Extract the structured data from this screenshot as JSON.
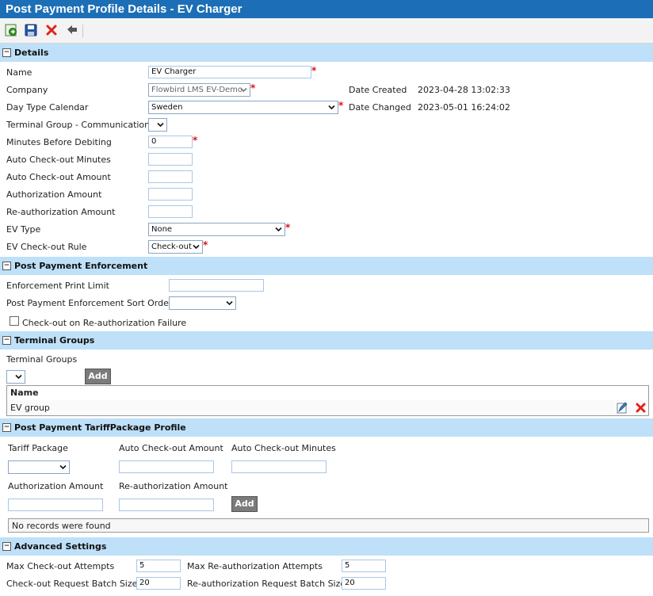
{
  "window": {
    "title": "Post Payment Profile Details - EV Charger"
  },
  "toolbar": {
    "icons": [
      "save-new-icon",
      "save-icon",
      "delete-icon",
      "back-icon"
    ]
  },
  "details": {
    "section_title": "Details",
    "name_label": "Name",
    "name_value": "EV Charger",
    "company_label": "Company",
    "company_value": "Flowbird LMS EV-Demo",
    "date_created_label": "Date Created",
    "date_created_value": "2023-04-28 13:02:33",
    "day_type_label": "Day Type Calendar",
    "day_type_value": "Sweden",
    "date_changed_label": "Date Changed",
    "date_changed_value": "2023-05-01 16:24:02",
    "terminal_group_comm_label": "Terminal Group - Communication",
    "terminal_group_comm_value": "",
    "minutes_before_label": "Minutes Before Debiting",
    "minutes_before_value": "0",
    "auto_checkout_minutes_label": "Auto Check-out Minutes",
    "auto_checkout_minutes_value": "",
    "auto_checkout_amount_label": "Auto Check-out Amount",
    "auto_checkout_amount_value": "",
    "authorization_amount_label": "Authorization Amount",
    "authorization_amount_value": "",
    "reauth_amount_label": "Re-authorization Amount",
    "reauth_amount_value": "",
    "ev_type_label": "EV Type",
    "ev_type_value": "None",
    "ev_checkout_rule_label": "EV Check-out Rule",
    "ev_checkout_rule_value": "Check-out",
    "required_marker": "*"
  },
  "enforcement": {
    "section_title": "Post Payment Enforcement",
    "print_limit_label": "Enforcement Print Limit",
    "print_limit_value": "",
    "sort_order_label": "Post Payment Enforcement Sort Order",
    "sort_order_value": "",
    "checkout_on_failure_label": "Check-out on Re-authorization Failure",
    "checkout_on_failure_checked": false
  },
  "terminal_groups": {
    "section_title": "Terminal Groups",
    "field_label": "Terminal Groups",
    "select_value": "",
    "add_label": "Add",
    "grid_header": "Name",
    "rows": [
      {
        "name": "EV group"
      }
    ]
  },
  "tariff": {
    "section_title": "Post Payment TariffPackage Profile",
    "tariff_package_label": "Tariff Package",
    "tariff_package_value": "",
    "auto_checkout_amount_label": "Auto Check-out Amount",
    "auto_checkout_amount_value": "",
    "auto_checkout_minutes_label": "Auto Check-out Minutes",
    "auto_checkout_minutes_value": "",
    "authorization_amount_label": "Authorization Amount",
    "authorization_amount_value": "",
    "reauth_amount_label": "Re-authorization Amount",
    "reauth_amount_value": "",
    "add_label": "Add",
    "empty_message": "No records were found"
  },
  "advanced": {
    "section_title": "Advanced Settings",
    "max_checkout_label": "Max Check-out Attempts",
    "max_checkout_value": "5",
    "max_reauth_label": "Max Re-authorization Attempts",
    "max_reauth_value": "5",
    "checkout_batch_label": "Check-out Request Batch Size",
    "checkout_batch_value": "20",
    "reauth_batch_label": "Re-authorization Request Batch Size",
    "reauth_batch_value": "20"
  },
  "colors": {
    "title_bar": "#1c6fb6",
    "section_header": "#bee0f8",
    "required": "#e01010",
    "button": "#7b7b7b"
  }
}
